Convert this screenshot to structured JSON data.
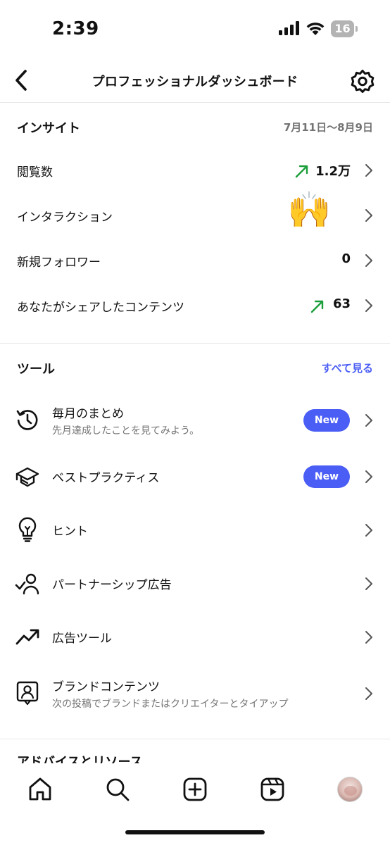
{
  "status_bar": {
    "time": "2:39",
    "battery": "16"
  },
  "header": {
    "title": "プロフェッショナルダッシュボード"
  },
  "insights": {
    "title": "インサイト",
    "date_range": "7月11日〜8月9日",
    "rows": [
      {
        "label": "閲覧数",
        "value": "1.2万",
        "trend": "up"
      },
      {
        "label": "インタラクション",
        "value": "",
        "trend": ""
      },
      {
        "label": "新規フォロワー",
        "value": "0",
        "trend": ""
      },
      {
        "label": "あなたがシェアしたコンテンツ",
        "value": "63",
        "trend": "up"
      }
    ]
  },
  "tools": {
    "title": "ツール",
    "see_all": "すべて見る",
    "items": [
      {
        "label": "毎月のまとめ",
        "sub": "先月達成したことを見てみよう。",
        "badge": "New",
        "icon": "history-icon"
      },
      {
        "label": "ベストプラクティス",
        "sub": "",
        "badge": "New",
        "icon": "graduation-cap-icon"
      },
      {
        "label": "ヒント",
        "sub": "",
        "badge": "",
        "icon": "lightbulb-icon"
      },
      {
        "label": "パートナーシップ広告",
        "sub": "",
        "badge": "",
        "icon": "partnership-icon"
      },
      {
        "label": "広告ツール",
        "sub": "",
        "badge": "",
        "icon": "trending-up-icon"
      },
      {
        "label": "ブランドコンテンツ",
        "sub": "次の投稿でブランドまたはクリエイターとタイアップ",
        "badge": "",
        "icon": "brand-content-icon"
      }
    ]
  },
  "next_section": {
    "title": "アドバイスとリソース"
  },
  "overlay": {
    "emoji": "🙌"
  },
  "colors": {
    "accent": "#4a5df5",
    "trend_up": "#1a9e3a",
    "secondary_text": "#737373"
  },
  "bottom_nav": [
    "home-icon",
    "search-icon",
    "create-icon",
    "reels-icon",
    "profile-avatar"
  ]
}
